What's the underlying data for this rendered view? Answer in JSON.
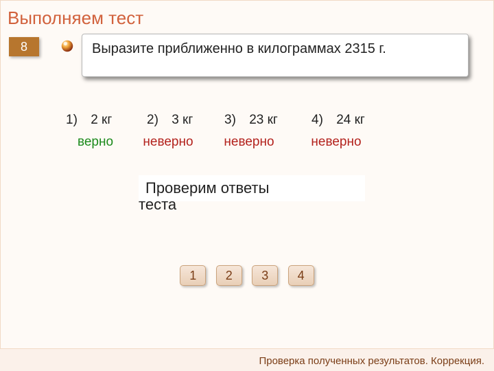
{
  "title": "Выполняем тест",
  "question_number": "8",
  "question_text": "Выразите приближенно в килограммах 2315 г.",
  "options": [
    {
      "index": "1)",
      "value": "2 кг",
      "feedback": "верно",
      "correct": true
    },
    {
      "index": "2)",
      "value": "3 кг",
      "feedback": "неверно",
      "correct": false
    },
    {
      "index": "3)",
      "value": "23 кг",
      "feedback": "неверно",
      "correct": false
    },
    {
      "index": "4)",
      "value": "24 кг",
      "feedback": "неверно",
      "correct": false
    }
  ],
  "reveal_line1": "Проверим ответы",
  "reveal_line2": "теста",
  "buttons": [
    "1",
    "2",
    "3",
    "4"
  ],
  "footer": "Проверка полученных результатов. Коррекция.",
  "colors": {
    "accent": "#b7762e",
    "title": "#d1613c",
    "correct": "#1c8a1c",
    "wrong": "#b3221d"
  }
}
